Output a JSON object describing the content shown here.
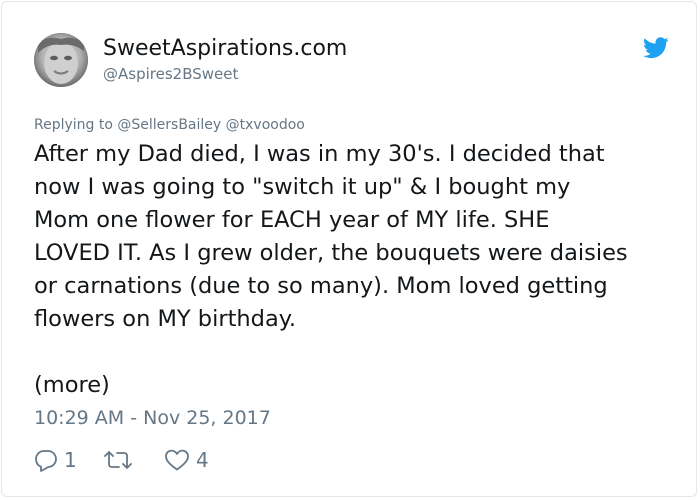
{
  "tweet": {
    "display_name": "SweetAspirations.com",
    "handle": "@Aspires2BSweet",
    "replying_to": "Replying to @SellersBailey @txvoodoo",
    "body": "After my Dad died, I was in my 30's. I decided that\nnow I was going to \"switch it up\" & I bought my\nMom one flower for EACH year of MY life. SHE\nLOVED IT. As I grew older, the bouquets were daisies\nor carnations (due to so many). Mom loved getting\nflowers on MY birthday.",
    "more_label": "(more)",
    "timestamp": "10:29 AM - Nov 25, 2017"
  },
  "actions": {
    "reply_count": "1",
    "retweet_count": "",
    "like_count": "4"
  },
  "icons": {
    "brand": "twitter-bird-icon",
    "reply": "reply-icon",
    "retweet": "retweet-icon",
    "like": "heart-icon"
  },
  "colors": {
    "twitter_blue": "#1da1f2",
    "secondary_text": "#657786",
    "primary_text": "#14171a"
  }
}
